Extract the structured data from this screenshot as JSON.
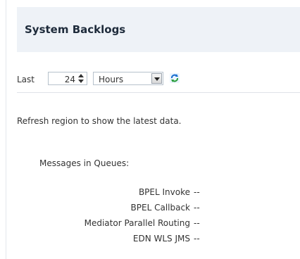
{
  "panel": {
    "title": "System Backlogs",
    "controls": {
      "last_label": "Last",
      "window_value": "24",
      "unit_selected": "Hours",
      "refresh_icon": "refresh-icon"
    },
    "note": "Refresh region to show the latest data.",
    "section_label": "Messages in Queues:",
    "rows": [
      {
        "name": "BPEL Invoke",
        "value": "--"
      },
      {
        "name": "BPEL Callback",
        "value": "--"
      },
      {
        "name": "Mediator Parallel Routing",
        "value": "--"
      },
      {
        "name": "EDN WLS JMS",
        "value": "--"
      }
    ]
  },
  "colors": {
    "header_bg": "#eef2f7",
    "title": "#1e2b3b",
    "text": "#333333"
  }
}
